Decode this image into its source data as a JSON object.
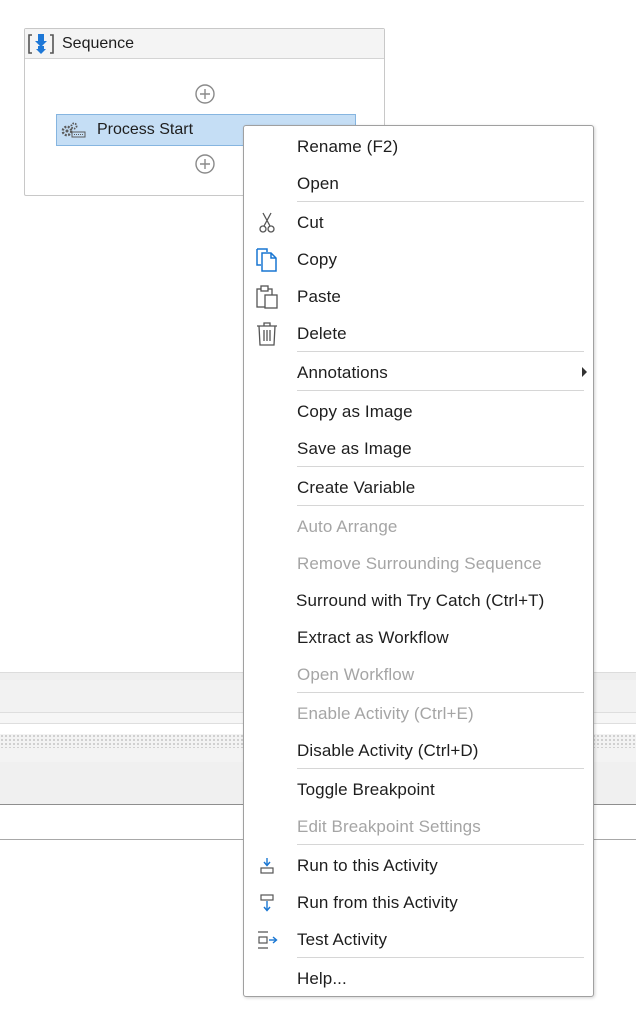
{
  "designer": {
    "sequence_title": "Sequence",
    "activity_label": "Process Start",
    "icons": {
      "sequence": "sequence-icon",
      "activity": "gears-icon",
      "add": "add-circle-icon"
    }
  },
  "context_menu": {
    "items": [
      {
        "label": "Rename (F2)",
        "icon": "",
        "enabled": true
      },
      {
        "label": "Open",
        "icon": "",
        "enabled": true
      },
      {
        "label": "Cut",
        "icon": "scissors-icon",
        "enabled": true
      },
      {
        "label": "Copy",
        "icon": "copy-icon",
        "enabled": true
      },
      {
        "label": "Paste",
        "icon": "clipboard-icon",
        "enabled": true
      },
      {
        "label": "Delete",
        "icon": "trash-icon",
        "enabled": true
      },
      {
        "label": "Annotations",
        "icon": "",
        "enabled": true,
        "submenu": true
      },
      {
        "label": "Copy as Image",
        "icon": "",
        "enabled": true
      },
      {
        "label": "Save as Image",
        "icon": "",
        "enabled": true
      },
      {
        "label": "Create Variable",
        "icon": "",
        "enabled": true
      },
      {
        "label": "Auto Arrange",
        "icon": "",
        "enabled": false
      },
      {
        "label": "Remove Surrounding Sequence",
        "icon": "",
        "enabled": false
      },
      {
        "label": "Surround with Try Catch (Ctrl+T)",
        "icon": "",
        "enabled": true
      },
      {
        "label": "Extract as Workflow",
        "icon": "",
        "enabled": true
      },
      {
        "label": "Open Workflow",
        "icon": "",
        "enabled": false
      },
      {
        "label": "Enable Activity (Ctrl+E)",
        "icon": "",
        "enabled": false
      },
      {
        "label": "Disable Activity (Ctrl+D)",
        "icon": "",
        "enabled": true
      },
      {
        "label": "Toggle Breakpoint",
        "icon": "",
        "enabled": true
      },
      {
        "label": "Edit Breakpoint Settings",
        "icon": "",
        "enabled": false
      },
      {
        "label": "Run to this Activity",
        "icon": "run-to-icon",
        "enabled": true
      },
      {
        "label": "Run from this Activity",
        "icon": "run-from-icon",
        "enabled": true
      },
      {
        "label": "Test Activity",
        "icon": "test-activity-icon",
        "enabled": true
      },
      {
        "label": "Help...",
        "icon": "",
        "enabled": true
      }
    ]
  },
  "colors": {
    "accent": "#1976d2",
    "selection": "#c5def5",
    "disabled_text": "#a5a5a5"
  }
}
